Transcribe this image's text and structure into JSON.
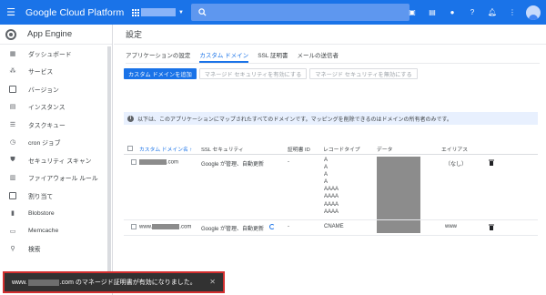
{
  "topbar": {
    "menu_icon": "hamburger-icon",
    "brand": "Google Cloud Platform",
    "project_icon": "project-dots-icon",
    "search_icon": "search-icon",
    "icons": [
      "gift-icon",
      "cloud-shell-icon",
      "help-icon",
      "help-icon-2",
      "notifications-icon",
      "more-icon"
    ],
    "accent": "#1a73e8"
  },
  "sidebar": {
    "title": "App Engine",
    "items": [
      {
        "label": "ダッシュボード",
        "icon": "dashboard-icon"
      },
      {
        "label": "サービス",
        "icon": "services-icon"
      },
      {
        "label": "バージョン",
        "icon": "versions-icon"
      },
      {
        "label": "インスタンス",
        "icon": "instances-icon"
      },
      {
        "label": "タスクキュー",
        "icon": "task-queue-icon"
      },
      {
        "label": "cron ジョブ",
        "icon": "cron-icon"
      },
      {
        "label": "セキュリティ スキャン",
        "icon": "security-scan-icon"
      },
      {
        "label": "ファイアウォール ルール",
        "icon": "firewall-icon"
      },
      {
        "label": "割り当て",
        "icon": "quota-icon"
      },
      {
        "label": "Blobstore",
        "icon": "blobstore-icon"
      },
      {
        "label": "Memcache",
        "icon": "memcache-icon"
      },
      {
        "label": "検索",
        "icon": "search-icon"
      }
    ]
  },
  "main": {
    "title": "設定",
    "tabs": [
      {
        "label": "アプリケーションの設定",
        "active": false
      },
      {
        "label": "カスタム ドメイン",
        "active": true
      },
      {
        "label": "SSL 証明書",
        "active": false
      },
      {
        "label": "メールの送信者",
        "active": false
      }
    ],
    "buttons": {
      "add": "カスタム ドメインを追加",
      "enable_managed": "マネージド セキュリティを有効にする",
      "disable_managed": "マネージド セキュリティを無効にする"
    },
    "info": "以下は、このアプリケーションにマップされたすべてのドメインです。マッピングを削除できるのはドメインの所有者のみです。",
    "table": {
      "headers": {
        "domain": "カスタム ドメイン名",
        "sort_arrow": "↑",
        "ssl": "SSL セキュリティ",
        "cert_id": "証明書 ID",
        "record_type": "レコードタイプ",
        "data": "データ",
        "alias": "エイリアス"
      },
      "rows": [
        {
          "domain_suffix": ".com",
          "ssl": "Google が管理、自動更新",
          "cert_id": "-",
          "record_types": [
            "A",
            "A",
            "A",
            "A",
            "AAAA",
            "AAAA",
            "AAAA",
            "AAAA"
          ],
          "alias": "（なし）"
        },
        {
          "domain_prefix": "www.",
          "domain_suffix": ".com",
          "ssl": "Google が管理、自動更新",
          "cert_id": "-",
          "record_types": [
            "CNAME"
          ],
          "alias": "www"
        }
      ]
    }
  },
  "snackbar": {
    "prefix": "www.",
    "suffix": ".com のマネージド証明書が有効になりました。",
    "close": "✕"
  }
}
